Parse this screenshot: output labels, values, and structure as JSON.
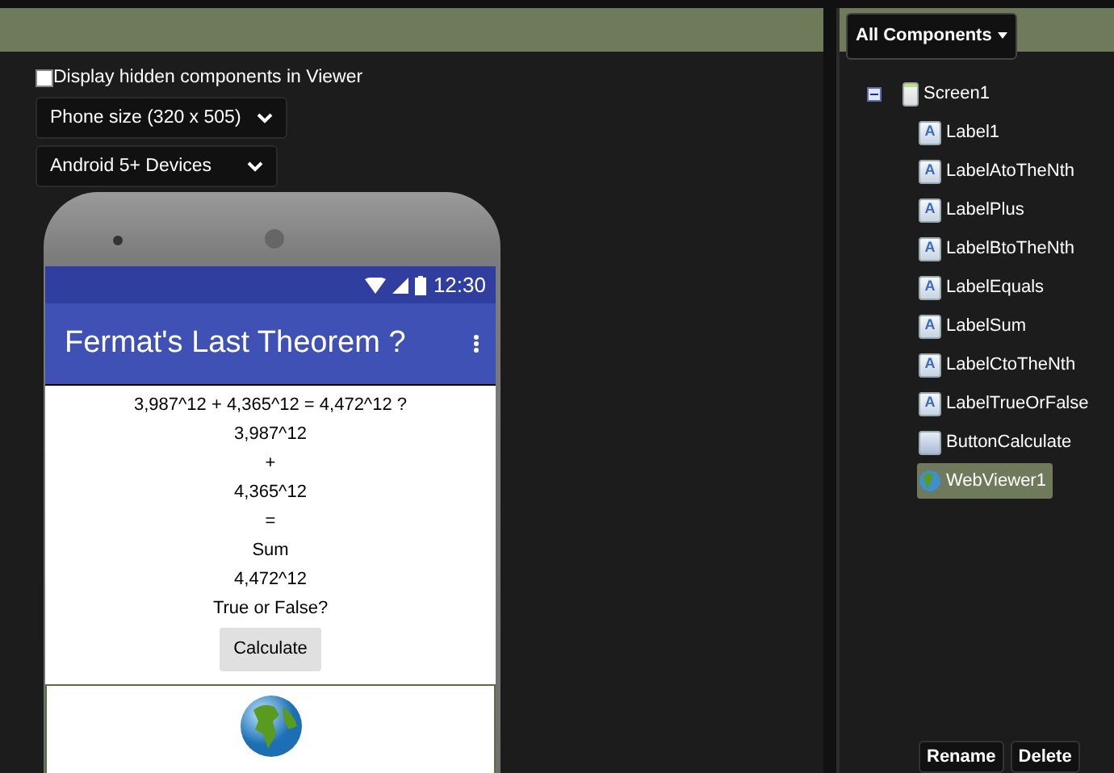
{
  "viewer": {
    "hidden_checkbox": {
      "label": "Display hidden components in Viewer",
      "checked": false
    },
    "size_select": "Phone size (320 x 505)",
    "device_select": "Android 5+ Devices",
    "phone": {
      "status_time": "12:30",
      "title": "Fermat's Last Theorem ?",
      "labels": [
        "3,987^12 + 4,365^12 = 4,472^12 ?",
        "3,987^12",
        "+",
        "4,365^12",
        "=",
        "Sum",
        "4,472^12",
        "True or False?"
      ],
      "button": "Calculate"
    }
  },
  "components": {
    "filter": "All Components",
    "tree": {
      "name": "Screen1",
      "kind": "screen",
      "expanded": true,
      "selected": false,
      "children": [
        {
          "name": "Label1",
          "kind": "label",
          "icon_text": "A",
          "selected": false
        },
        {
          "name": "LabelAtoTheNth",
          "kind": "label",
          "icon_text": "A",
          "selected": false
        },
        {
          "name": "LabelPlus",
          "kind": "label",
          "icon_text": "A",
          "selected": false
        },
        {
          "name": "LabelBtoTheNth",
          "kind": "label",
          "icon_text": "A",
          "selected": false
        },
        {
          "name": "LabelEquals",
          "kind": "label",
          "icon_text": "A",
          "selected": false
        },
        {
          "name": "LabelSum",
          "kind": "label",
          "icon_text": "A",
          "selected": false
        },
        {
          "name": "LabelCtoTheNth",
          "kind": "label",
          "icon_text": "A",
          "selected": false
        },
        {
          "name": "LabelTrueOrFalse",
          "kind": "label",
          "icon_text": "A",
          "selected": false
        },
        {
          "name": "ButtonCalculate",
          "kind": "button",
          "selected": false
        },
        {
          "name": "WebViewer1",
          "kind": "webviewer",
          "selected": true
        }
      ]
    },
    "buttons": [
      "Rename",
      "Delete"
    ]
  }
}
